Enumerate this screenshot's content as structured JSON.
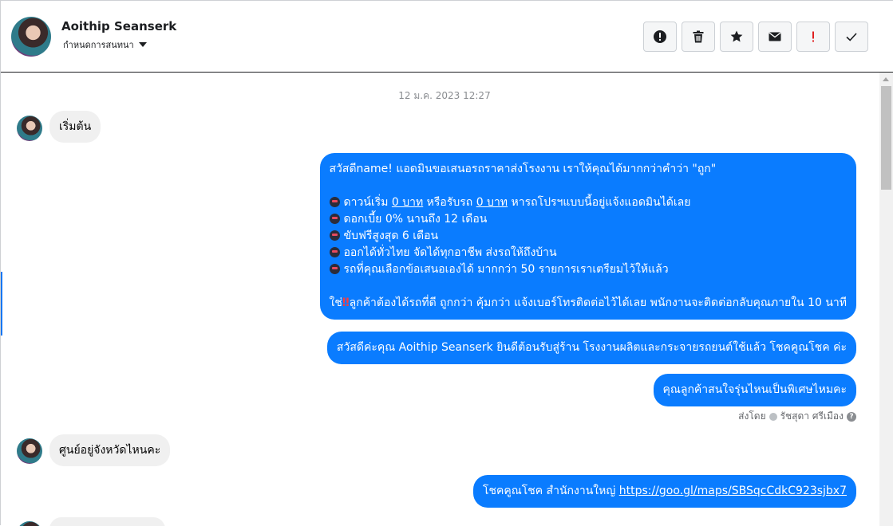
{
  "header": {
    "name": "Aoithip Seanserk",
    "subtitle": "กำหนดการสนทนา",
    "actions": [
      {
        "name": "spam-button",
        "icon": "alert-circle-icon"
      },
      {
        "name": "delete-button",
        "icon": "trash-icon"
      },
      {
        "name": "star-button",
        "icon": "star-icon"
      },
      {
        "name": "mark-unread-button",
        "icon": "envelope-icon"
      },
      {
        "name": "important-button",
        "icon": "exclamation-icon",
        "color": "#e02020"
      },
      {
        "name": "done-button",
        "icon": "check-icon"
      }
    ]
  },
  "conversation": {
    "timestamp": "12 ม.ค. 2023 12:27",
    "msg1": "เริ่มต้น",
    "msg2": {
      "line1": "สวัสดีname! แอดมินขอเสนอรถราคาส่งโรงงาน เราให้คุณได้มากกว่าคำว่า \"ถูก\"",
      "b1_pre": "ดาวน์เริ่ม ",
      "b1_u1": "0 บาท",
      "b1_mid": " หรือรับรถ ",
      "b1_u2": "0 บาท",
      "b1_post": " หารถโปรฯแบบนี้อยู่แจ้งแอดมินได้เลย",
      "b2": "ดอกเบี้ย 0% นานถึง 12 เดือน",
      "b3": "ขับฟรีสูงสุด 6 เดือน",
      "b4": "ออกได้ทั่วไทย จัดได้ทุกอาชีพ ส่งรถให้ถึงบ้าน",
      "b5": "รถที่คุณเลือกข้อเสนอเองได้ มากกว่า 50 รายการเราเตรียมไว้ให้แล้ว",
      "last_pre": "ใช่",
      "last_bang": "‼",
      "last_post": "ลูกค้าต้องได้รถที่ดี ถูกกว่า คุ้มกว่า แจ้งเบอร์โทรติดต่อไว้ได้เลย พนักงานจะติดต่อกลับคุณภายใน 10 นาที"
    },
    "msg3": "สวัสดีค่ะคุณ Aoithip Seanserk ยินดีต้อนรับสู่ร้าน โรงงานผลิตและกระจายรถยนต์ใช้แล้ว โชคคูณโชค ค่ะ",
    "msg4": "คุณลูกค้าสนใจรุ่นไหนเป็นพิเศษไหมคะ",
    "sent_by_label": "ส่งโดย",
    "sent_by_name": "รัชสุดา ศรีเมือง",
    "msg5": "ศูนย์อยู่จังหวัดไหนคะ",
    "msg6_pre": "โชคคูณโชค สำนักงานใหญ่ ",
    "msg6_link": "https://goo.gl/maps/SBSqcCdkC923sjbx7"
  }
}
